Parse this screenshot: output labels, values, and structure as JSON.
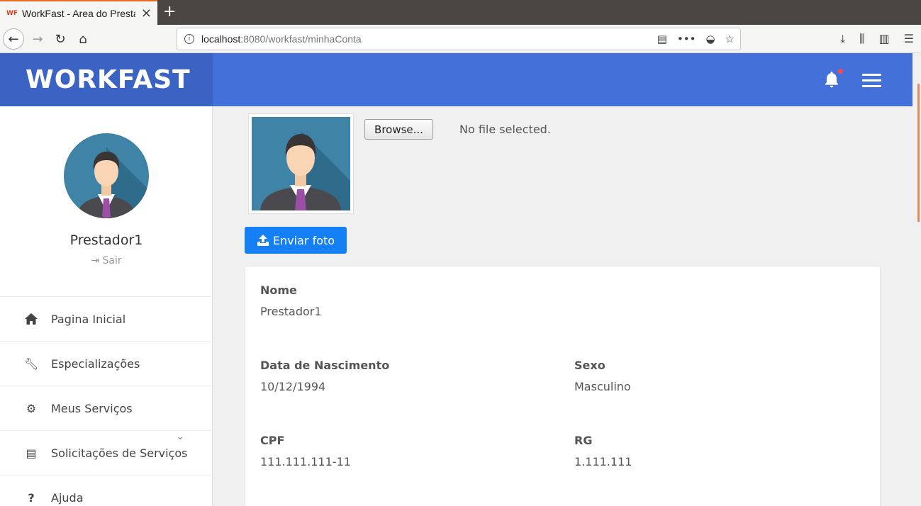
{
  "browser": {
    "tab_title": "WorkFast - Area do Prestador",
    "favicon_text": "WF",
    "url_host": "localhost",
    "url_rest": ":8080/workfast/minhaConta"
  },
  "header": {
    "brand": "WORKFAST"
  },
  "sidebar": {
    "user_name": "Prestador1",
    "logout_label": "Sair",
    "items": [
      {
        "label": "Pagina Inicial",
        "icon": "home-icon"
      },
      {
        "label": "Especializações",
        "icon": "wrench-icon"
      },
      {
        "label": "Meus Serviços",
        "icon": "gears-icon"
      },
      {
        "label": "Solicitações de Serviços",
        "icon": "list-icon"
      },
      {
        "label": "Ajuda",
        "icon": "question-icon"
      }
    ]
  },
  "photo": {
    "browse_label": "Browse...",
    "file_status": "No file selected.",
    "upload_label": "Enviar foto"
  },
  "profile": {
    "nome_label": "Nome",
    "nome_value": "Prestador1",
    "nascimento_label": "Data de Nascimento",
    "nascimento_value": "10/12/1994",
    "sexo_label": "Sexo",
    "sexo_value": "Masculino",
    "cpf_label": "CPF",
    "cpf_value": "111.111.111-11",
    "rg_label": "RG",
    "rg_value": "1.111.111"
  },
  "colors": {
    "header": "#4470d9",
    "brand_bg": "#3b63c4",
    "primary_button": "#157ff6",
    "notification_dot": "#ff4a4a"
  }
}
